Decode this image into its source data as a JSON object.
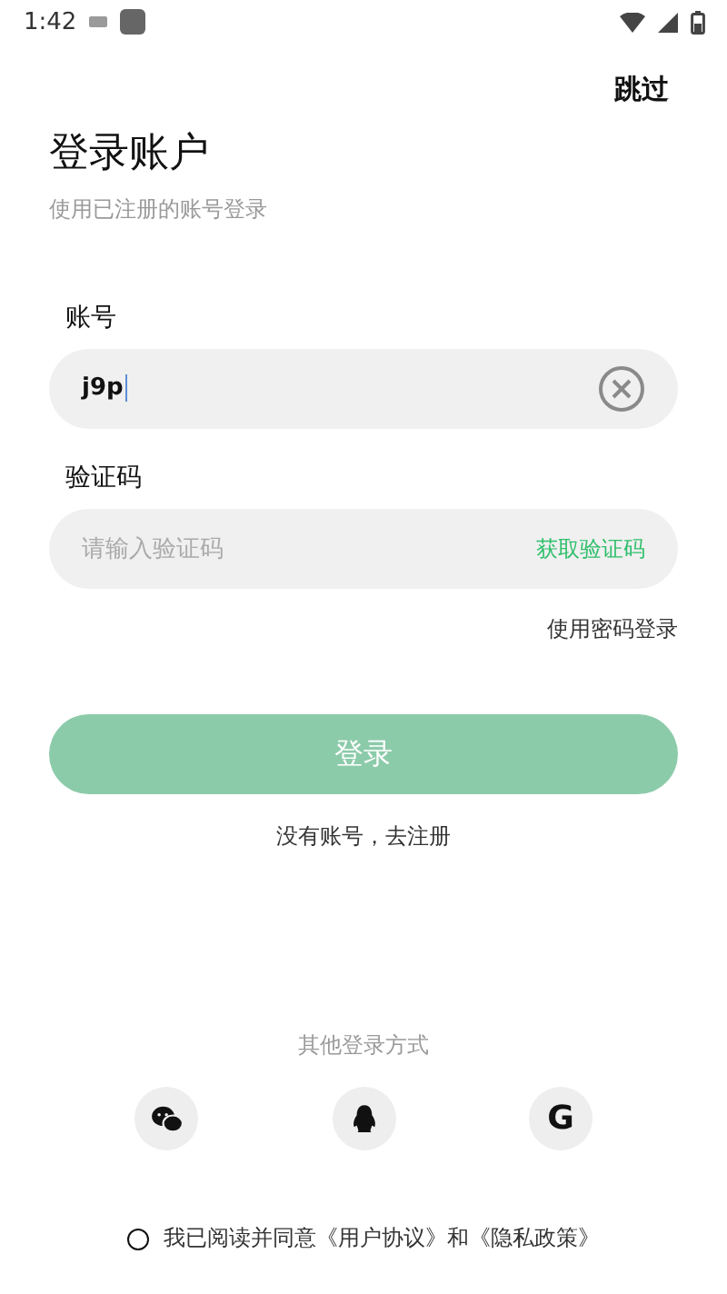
{
  "status_bar": {
    "time": "1:42"
  },
  "skip": "跳过",
  "title": "登录账户",
  "subtitle": "使用已注册的账号登录",
  "account": {
    "label": "账号",
    "value": "j9p"
  },
  "code": {
    "label": "验证码",
    "placeholder": "请输入验证码",
    "action": "获取验证码"
  },
  "password_login": "使用密码登录",
  "login_button": {
    "label": "登录",
    "disabled": true
  },
  "register": "没有账号，去注册",
  "other_login": {
    "title": "其他登录方式",
    "options": [
      {
        "kind": "wechat"
      },
      {
        "kind": "penguin"
      },
      {
        "kind": "letter",
        "text": "G"
      }
    ]
  },
  "agreement": {
    "checked": false,
    "text": "我已阅读并同意《用户协议》和《隐私政策》"
  }
}
